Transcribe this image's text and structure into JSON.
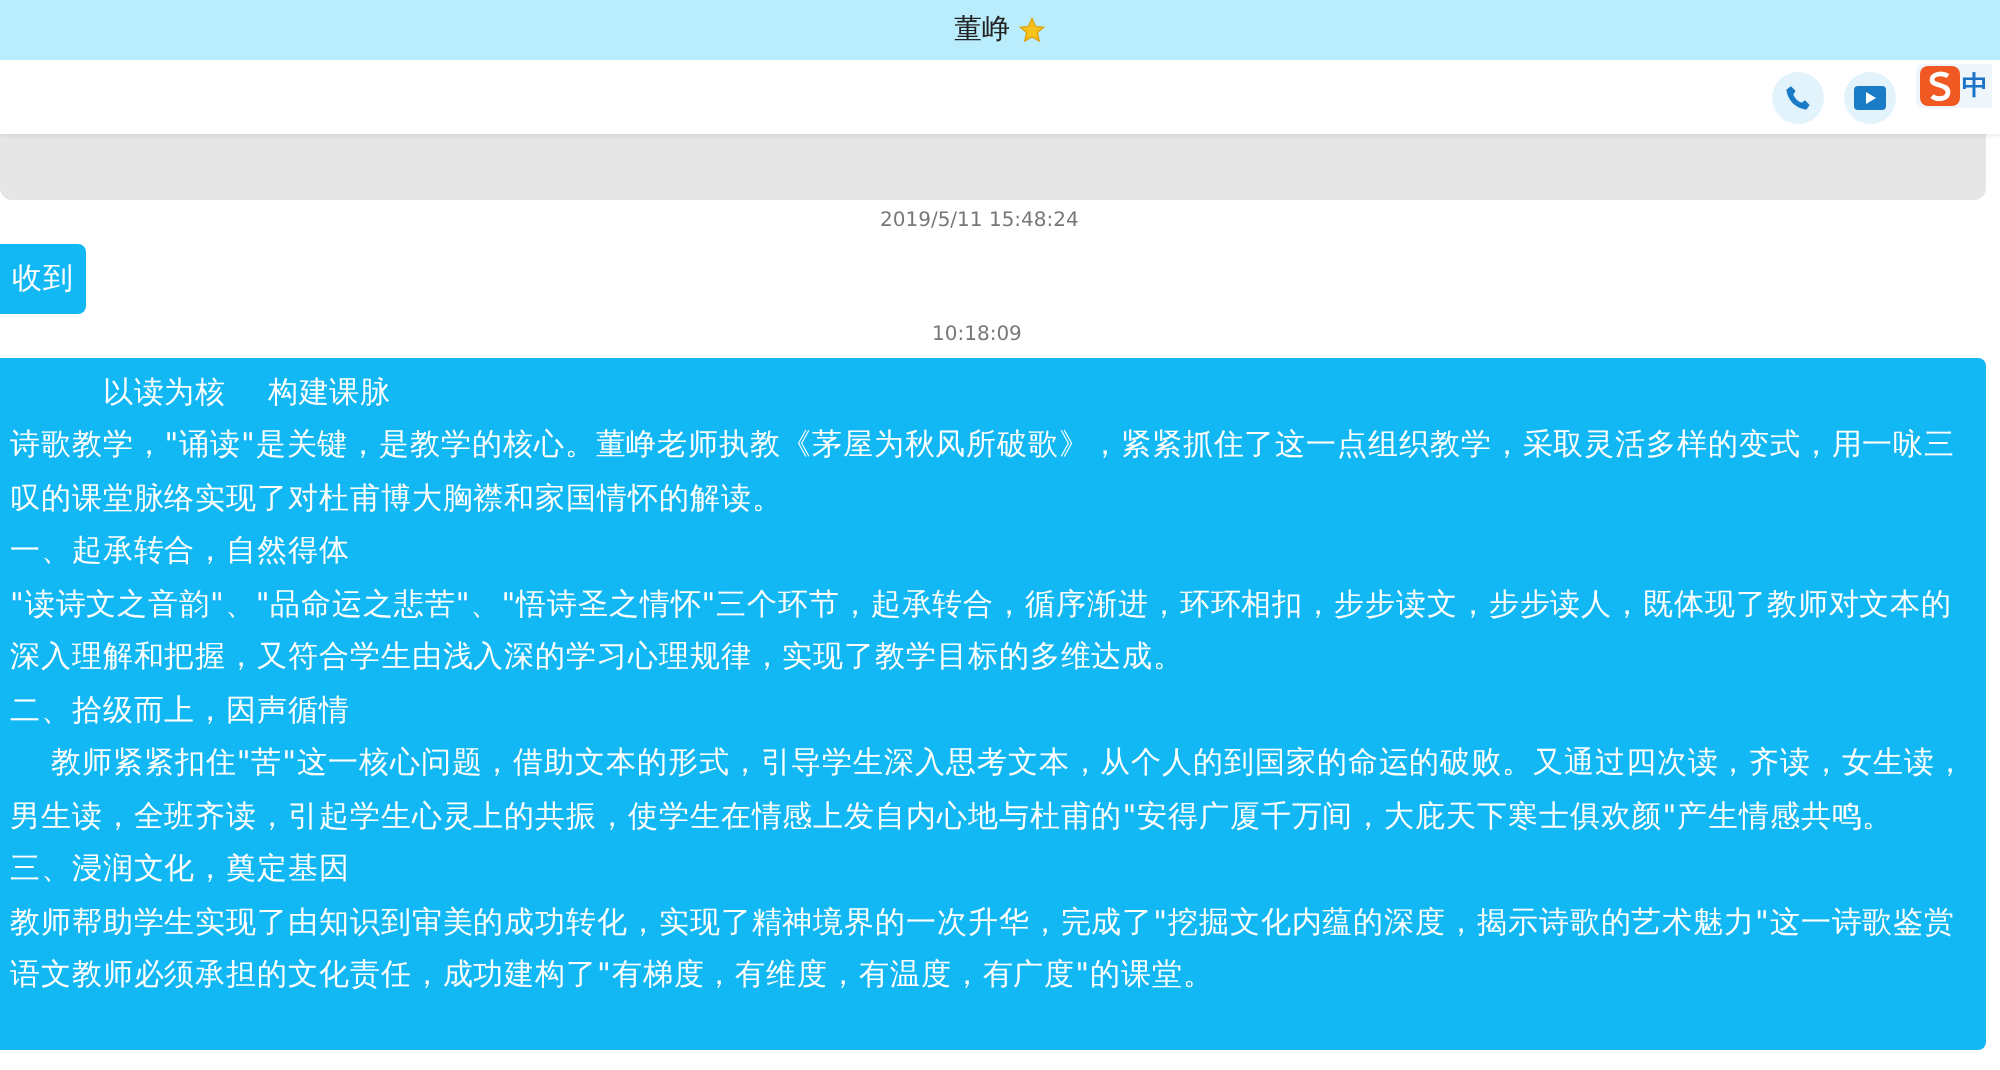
{
  "header": {
    "title": "董峥"
  },
  "messages": [
    {
      "kind": "received",
      "time": "2019/5/11 15:48:24"
    },
    {
      "kind": "sent",
      "paragraphs": [
        "收到"
      ],
      "time": "10:18:09"
    },
    {
      "kind": "sent",
      "paragraphs": [
        "　　　以读为核　 构建课脉",
        "诗歌教学，\"诵读\"是关键，是教学的核心。董峥老师执教《茅屋为秋风所破歌》，紧紧抓住了这一点组织教学，采取灵活多样的变式，用一咏三叹的课堂脉络实现了对杜甫博大胸襟和家国情怀的解读。",
        "一、起承转合，自然得体",
        "\"读诗文之音韵\"、\"品命运之悲苦\"、\"悟诗圣之情怀\"三个环节，起承转合，循序渐进，环环相扣，步步读文，步步读人，既体现了教师对文本的深入理解和把握，又符合学生由浅入深的学习心理规律，实现了教学目标的多维达成。",
        "二、拾级而上，因声循情",
        "　 教师紧紧扣住\"苦\"这一核心问题，借助文本的形式，引导学生深入思考文本，从个人的到国家的命运的破败。又通过四次读，齐读，女生读，男生读，全班齐读，引起学生心灵上的共振，使学生在情感上发自内心地与杜甫的\"安得广厦千万间，大庇天下寒士俱欢颜\"产生情感共鸣。",
        "三、浸润文化，奠定基因",
        "教师帮助学生实现了由知识到审美的成功转化，实现了精神境界的一次升华，完成了\"挖掘文化内蕴的深度，揭示诗歌的艺术魅力\"这一诗歌鉴赏",
        "语文教师必须承担的文化责任，成功建构了\"有梯度，有维度，有温度，有广度\"的课堂。"
      ]
    }
  ],
  "ime": {
    "mode": "中"
  }
}
